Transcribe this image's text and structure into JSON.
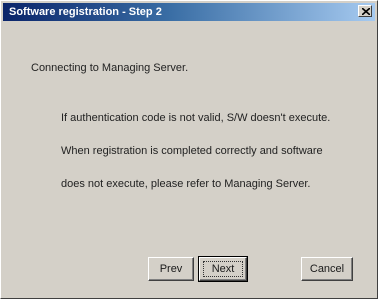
{
  "window": {
    "title": "Software registration - Step 2",
    "close_icon": "close-icon"
  },
  "content": {
    "connecting": "Connecting to Managing Server.",
    "info_line1": "If authentication code is not valid, S/W doesn't execute.",
    "info_line2": "When registration is completed correctly and software",
    "info_line3": "does not execute, please refer to Managing Server."
  },
  "buttons": {
    "prev": "Prev",
    "next": "Next",
    "cancel": "Cancel"
  },
  "colors": {
    "titlebar_start": "#0a246a",
    "titlebar_end": "#a6caf0",
    "dialog_face": "#d4d0c8"
  }
}
